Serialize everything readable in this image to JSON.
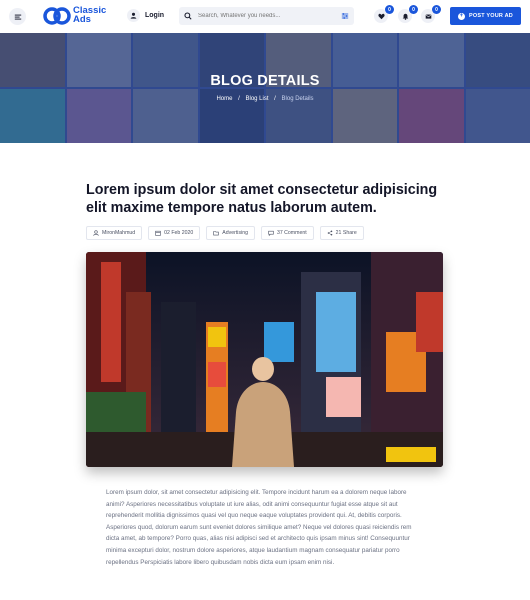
{
  "header": {
    "logo_line1": "Classic",
    "logo_line2": "Ads",
    "login_label": "Login",
    "search_placeholder": "Search, Whatever you needs...",
    "favorites_count": "0",
    "notifications_count": "0",
    "messages_count": "0",
    "post_button_label": "POST YOUR AD",
    "accent_color": "#1a56db"
  },
  "banner": {
    "title": "BLOG DETAILS",
    "breadcrumb": [
      "Home",
      "Blog List",
      "Blog Details"
    ]
  },
  "article": {
    "title": "Lorem ipsum dolor sit amet consectetur adipisicing elit maxime tempore natus laborum autem.",
    "meta": {
      "author": "MironMahmud",
      "date": "02 Feb 2020",
      "category": "Advertising",
      "comments": "37 Comment",
      "shares": "21 Share"
    },
    "body": "Lorem ipsum dolor, sit amet consectetur adipisicing elit. Tempore incidunt harum ea a dolorem neque labore animi? Asperiores necessitatibus voluptate ut iure alias, odit animi consequuntur fugiat esse atque sit aut reprehenderit mollitia dignissimos quasi vel quo neque eaque voluptates provident qui. At, debitis corporis. Asperiores quod, dolorum earum sunt eveniet dolores similique amet? Neque vel dolores quasi reiciendis rem dicta amet, ab tempore? Porro quas, alias nisi adipisci sed et architecto quis ipsam minus sint! Consequuntur minima excepturi dolor, nostrum dolore asperiores, atque laudantium magnam consequatur pariatur porro repellendus Perspiciatis labore libero quibusdam nobis dicta eum ipsam enim nisi."
  }
}
